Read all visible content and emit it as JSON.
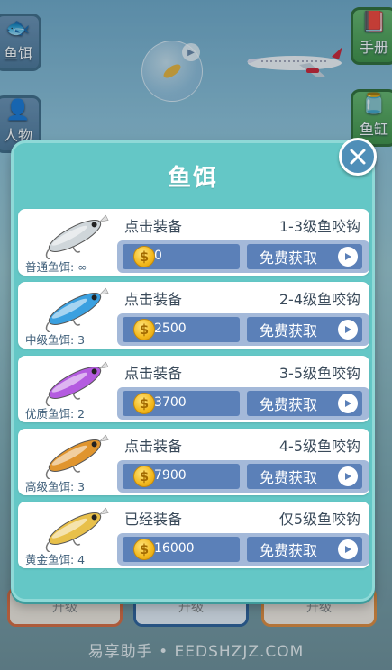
{
  "hud": {
    "left_top_label": "鱼饵",
    "left_bottom_label": "人物",
    "right_top_label": "手册",
    "right_bottom_label": "鱼缸"
  },
  "bottom_buttons": [
    "升级",
    "升级",
    "升级"
  ],
  "modal": {
    "title": "鱼饵",
    "free_label": "免费获取",
    "baits": [
      {
        "name": "普通鱼饵: ∞",
        "status": "点击装备",
        "levels": "1-3级鱼咬钩",
        "price": "0",
        "color": "#cfd6da"
      },
      {
        "name": "中级鱼饵: 3",
        "status": "点击装备",
        "levels": "2-4级鱼咬钩",
        "price": "2500",
        "color": "#3aa0e0"
      },
      {
        "name": "优质鱼饵: 2",
        "status": "点击装备",
        "levels": "3-5级鱼咬钩",
        "price": "3700",
        "color": "#b45be0"
      },
      {
        "name": "高级鱼饵: 3",
        "status": "点击装备",
        "levels": "4-5级鱼咬钩",
        "price": "7900",
        "color": "#e0952e"
      },
      {
        "name": "黄金鱼饵: 4",
        "status": "已经装备",
        "levels": "仅5级鱼咬钩",
        "price": "16000",
        "color": "#e8c04a"
      }
    ]
  },
  "watermark": "易享助手 • EEDSHZJZ.COM",
  "colors": {
    "modal_bg": "#64c7c6",
    "band": "#a4b9d9",
    "button": "#5b80b8",
    "close": "#4f8fb8"
  }
}
